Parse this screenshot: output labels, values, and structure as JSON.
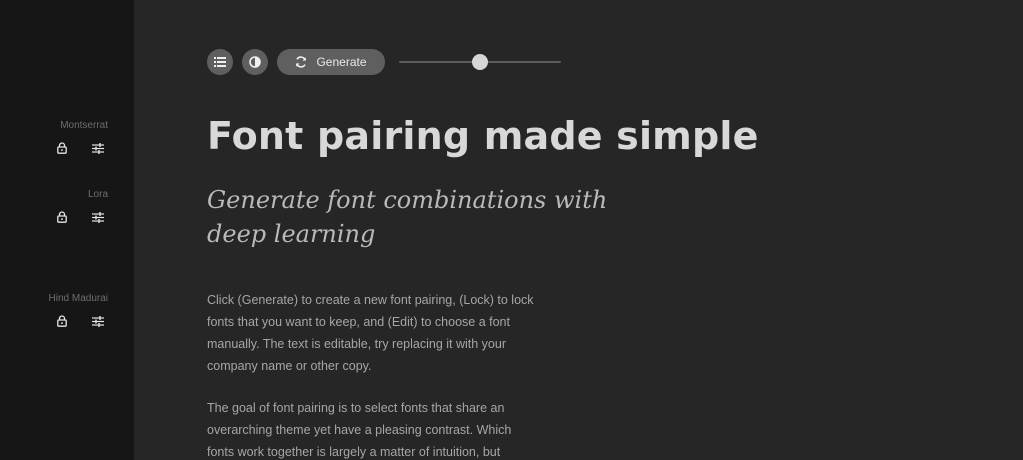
{
  "sidebar": {
    "fonts": [
      {
        "name": "Montserrat",
        "lock_icon": "lock-icon",
        "edit_icon": "sliders-icon"
      },
      {
        "name": "Lora",
        "lock_icon": "lock-icon",
        "edit_icon": "sliders-icon"
      },
      {
        "name": "Hind Madurai",
        "lock_icon": "lock-icon",
        "edit_icon": "sliders-icon"
      }
    ]
  },
  "toolbar": {
    "list_icon": "list-icon",
    "contrast_icon": "contrast-icon",
    "generate_label": "Generate",
    "generate_icon": "refresh-icon",
    "slider_value": 0.5
  },
  "content": {
    "headline": "Font pairing made simple",
    "subheadline": "Generate font combinations with deep learning",
    "paragraph1": "Click (Generate) to create a new font pairing, (Lock) to lock fonts that you want to keep, and (Edit) to choose a font manually. The text is editable, try replacing it with your company name or other copy.",
    "paragraph2": "The goal of font pairing is to select fonts that share an overarching theme yet have a pleasing contrast. Which fonts work together is largely a matter of intuition, but"
  },
  "colors": {
    "sidebar_bg": "#161616",
    "main_bg": "#262626",
    "button_bg": "#5f5f5f",
    "headline": "#d8d8d8",
    "subheadline": "#b9b9b9",
    "body": "#a6a6a6"
  }
}
